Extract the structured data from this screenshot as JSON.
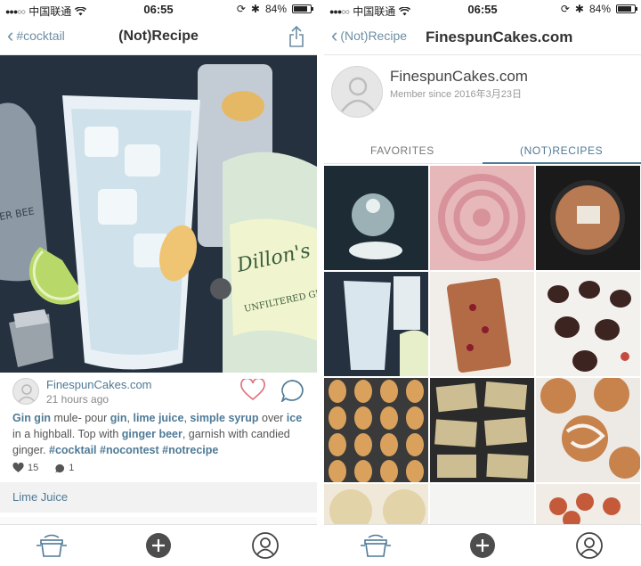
{
  "status_left": {
    "carrier": "中国联通",
    "time": "06:55",
    "battery": "84%",
    "battery_level": 0.84
  },
  "status_right": {
    "carrier": "中国联通",
    "time": "06:55",
    "battery": "84%",
    "battery_level": 0.84
  },
  "left_screen": {
    "nav": {
      "back_label": "#cocktail",
      "title": "(Not)Recipe"
    },
    "post": {
      "username": "FinespunCakes.com",
      "time_ago": "21 hours ago",
      "caption": [
        {
          "t": "Gin gin",
          "tag": true
        },
        {
          "t": " mule- pour ",
          "tag": false
        },
        {
          "t": "gin",
          "tag": true
        },
        {
          "t": ", ",
          "tag": false
        },
        {
          "t": "lime juice",
          "tag": true
        },
        {
          "t": ", ",
          "tag": false
        },
        {
          "t": "simple syrup",
          "tag": true
        },
        {
          "t": " over ",
          "tag": false
        },
        {
          "t": "ice",
          "tag": true
        },
        {
          "t": " in a highball. Top with ",
          "tag": false
        },
        {
          "t": "ginger beer",
          "tag": true
        },
        {
          "t": ", garnish with candied ginger. ",
          "tag": false
        },
        {
          "t": "#cocktail #nocontest #notrecipe",
          "tag": true
        }
      ],
      "likes": "15",
      "comments": "1"
    },
    "ingredient": "Lime Juice"
  },
  "right_screen": {
    "nav": {
      "back_label": "(Not)Recipe",
      "title": "FinespunCakes.com"
    },
    "profile": {
      "name": "FinespunCakes.com",
      "member_since": "Member since 2016年3月23日"
    },
    "tabs": {
      "favorites": "FAVORITES",
      "recipes": "(NOT)RECIPES"
    },
    "grid_items": [
      "cake-pop-photo",
      "frosted-cake-photo",
      "skillet-cookie-photo",
      "gin-cocktail-photo",
      "cranberry-bread-photo",
      "chocolate-bonbons-photo",
      "madeleines-photo",
      "granola-bars-photo",
      "cinnamon-rolls-photo",
      "stamped-cookies-photo",
      "white-plate-photo",
      "glazed-pastries-photo"
    ]
  },
  "colors": {
    "accent": "#4f7a96",
    "text": "#555555",
    "divider": "#e4e4e4",
    "tab_bg": "#f2f2f2"
  },
  "tabbar_icons": [
    "pot-icon",
    "add-icon",
    "profile-icon"
  ]
}
